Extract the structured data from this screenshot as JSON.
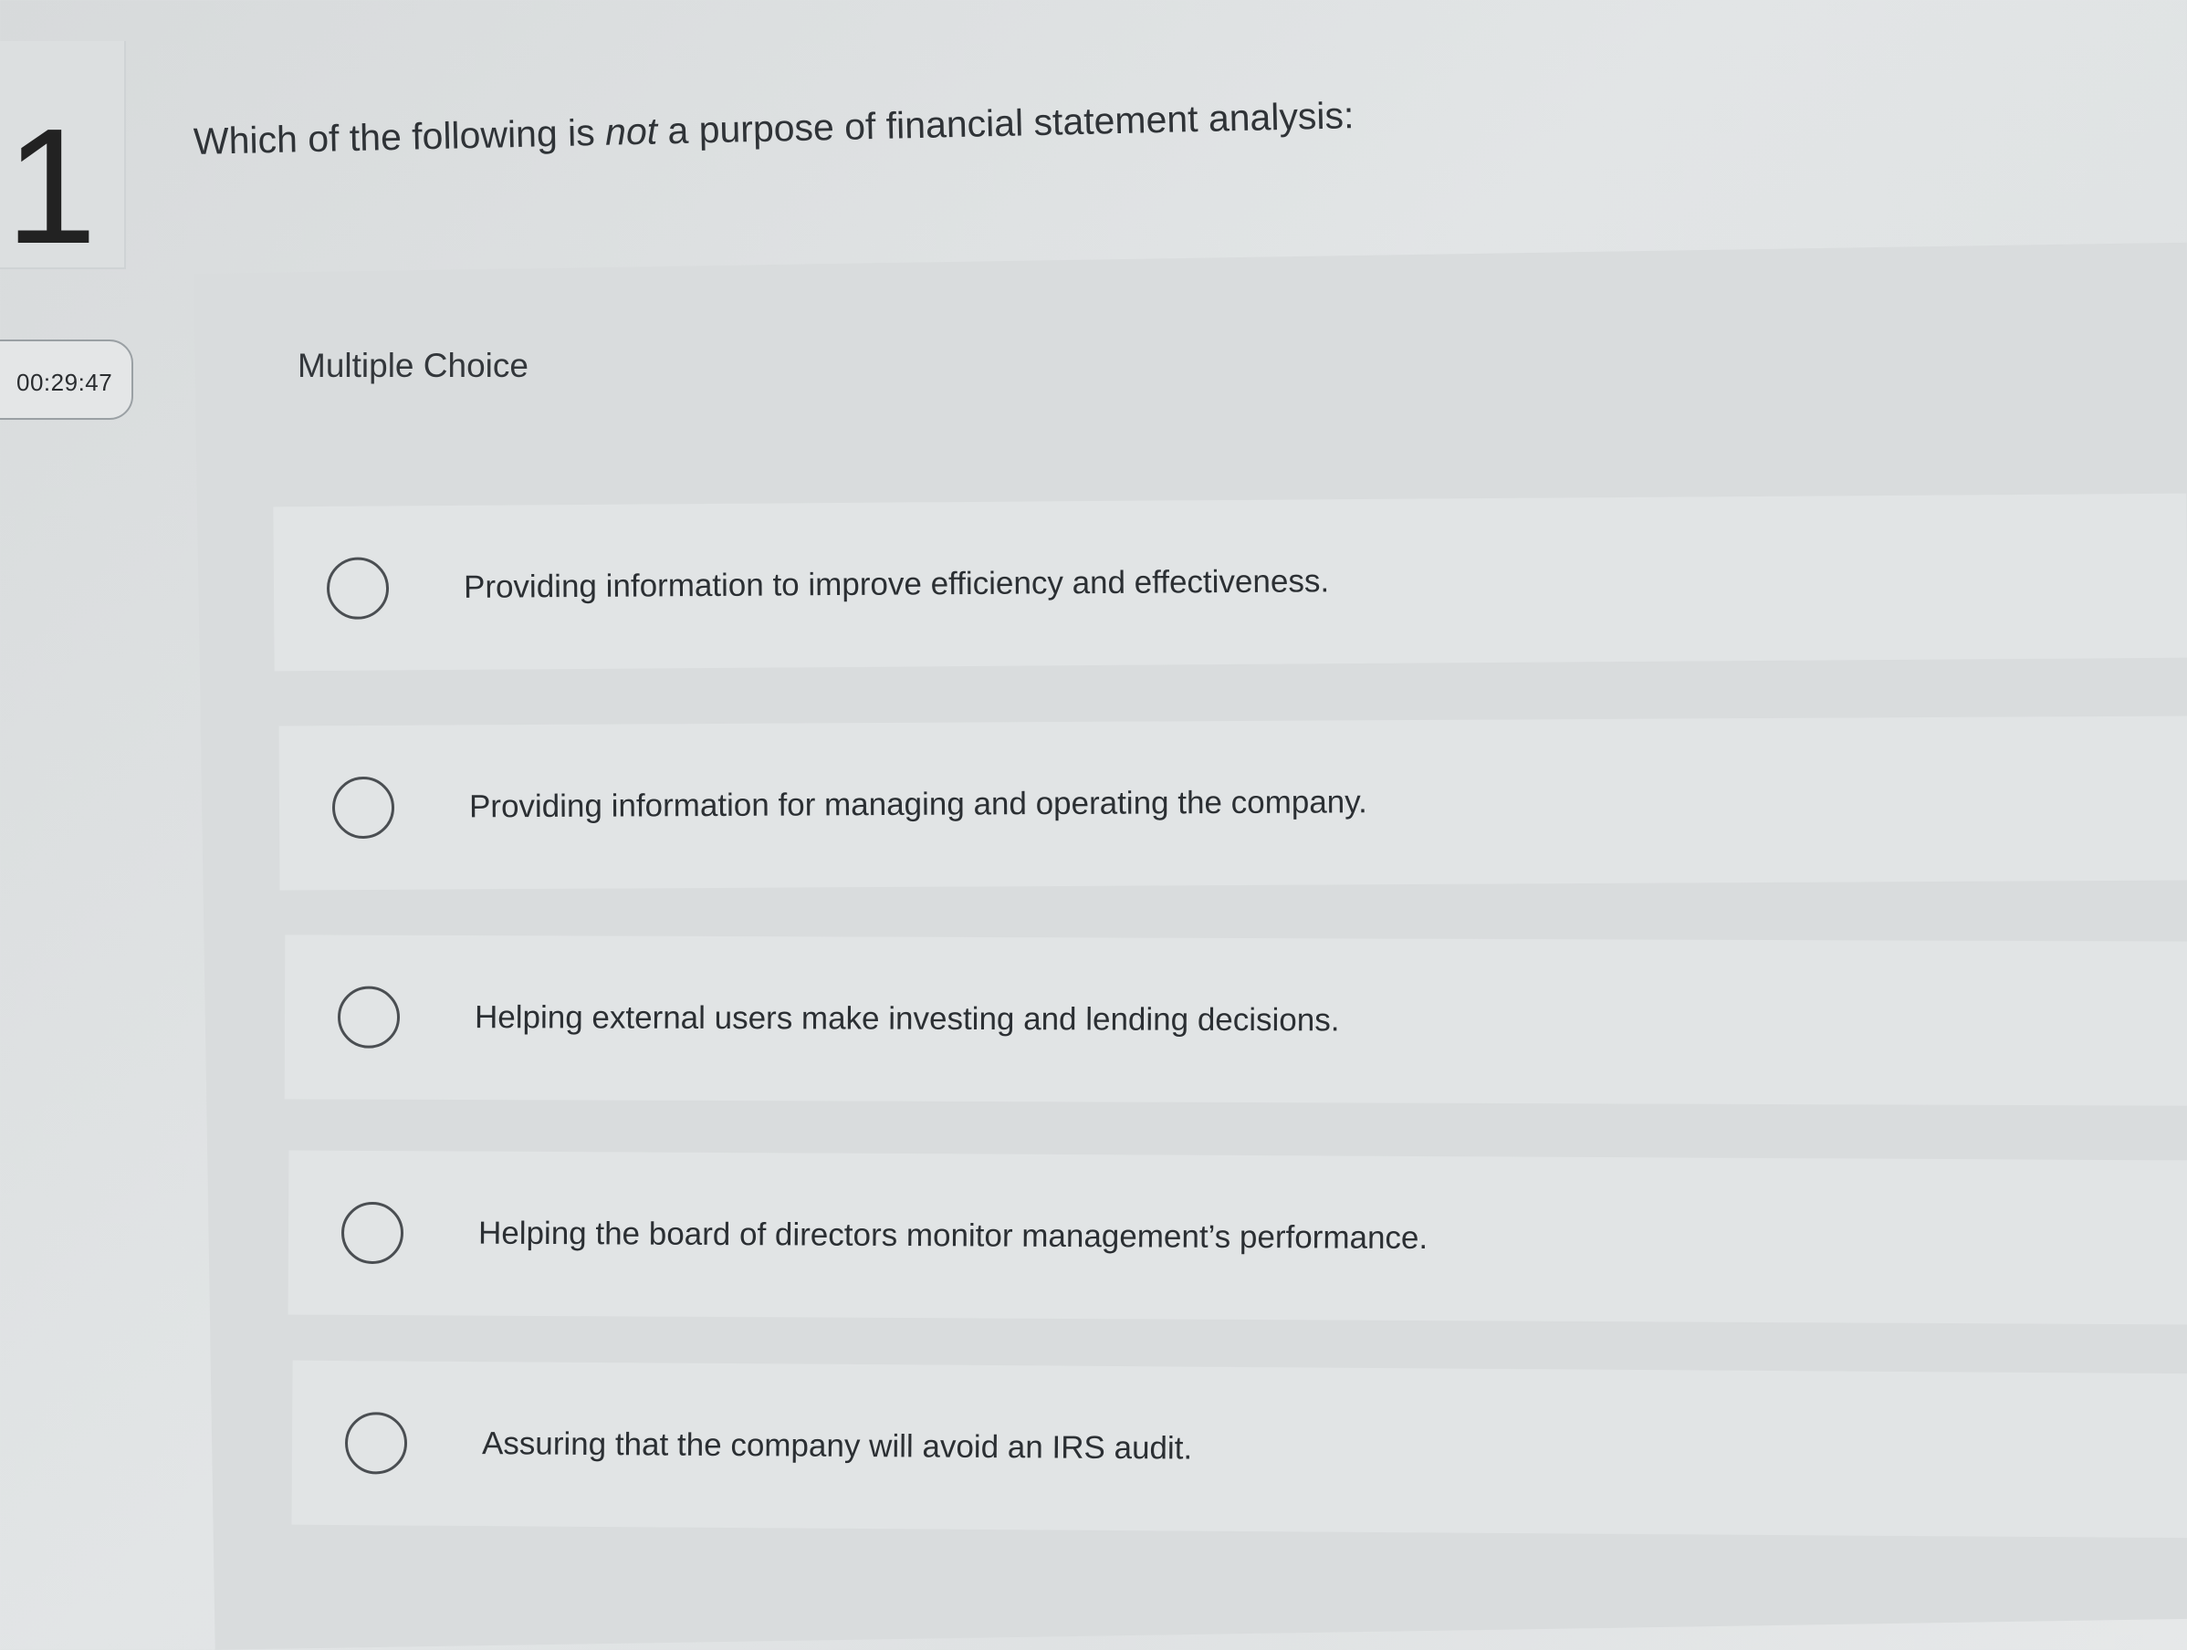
{
  "question": {
    "number": "1",
    "prompt_before": "Which of the following is ",
    "prompt_emphasis": "not",
    "prompt_after": " a purpose of financial statement analysis:"
  },
  "timer": {
    "value": "00:29:47"
  },
  "question_type": "Multiple Choice",
  "options": [
    {
      "label": "Providing information to improve efficiency and effectiveness.",
      "selected": false
    },
    {
      "label": "Providing information for managing and operating the company.",
      "selected": false
    },
    {
      "label": "Helping external users make investing and lending decisions.",
      "selected": false
    },
    {
      "label": "Helping the board of directors monitor management’s performance.",
      "selected": false
    },
    {
      "label": "Assuring that the company will avoid an IRS audit.",
      "selected": false
    }
  ]
}
